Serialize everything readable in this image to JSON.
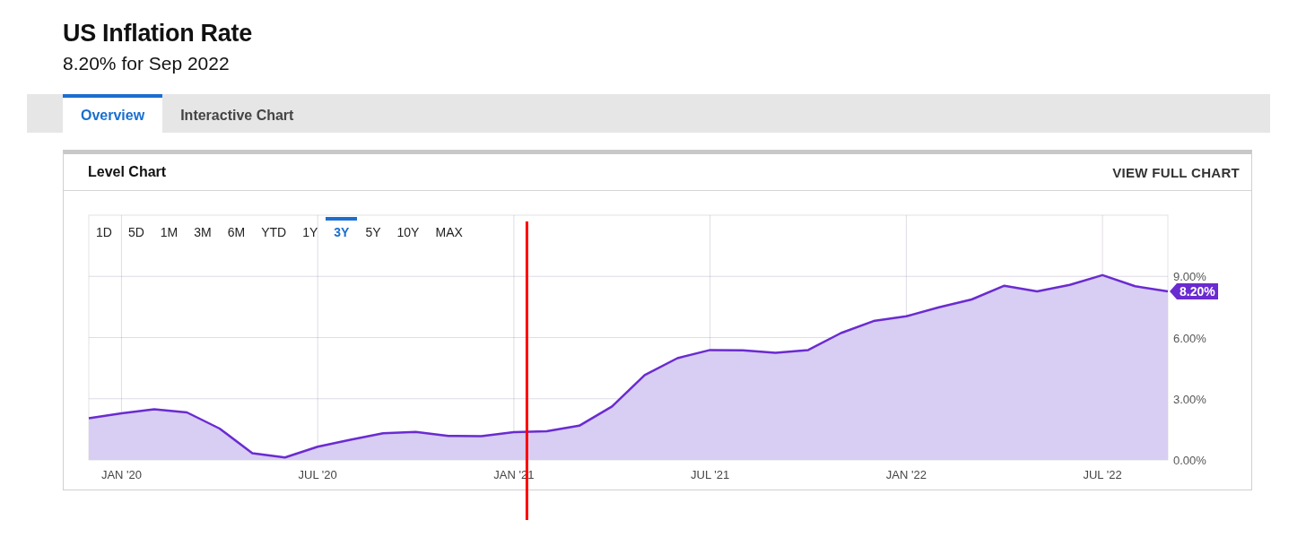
{
  "header": {
    "title": "US Inflation Rate",
    "subtitle": "8.20% for Sep 2022"
  },
  "tabs": [
    {
      "label": "Overview",
      "selected": true
    },
    {
      "label": "Interactive Chart",
      "selected": false
    }
  ],
  "card": {
    "title": "Level Chart",
    "action": "VIEW FULL CHART",
    "ranges": [
      {
        "label": "1D",
        "selected": false
      },
      {
        "label": "5D",
        "selected": false
      },
      {
        "label": "1M",
        "selected": false
      },
      {
        "label": "3M",
        "selected": false
      },
      {
        "label": "6M",
        "selected": false
      },
      {
        "label": "YTD",
        "selected": false
      },
      {
        "label": "1Y",
        "selected": false
      },
      {
        "label": "3Y",
        "selected": true
      },
      {
        "label": "5Y",
        "selected": false
      },
      {
        "label": "10Y",
        "selected": false
      },
      {
        "label": "MAX",
        "selected": false
      }
    ],
    "last_value_label": "8.20%",
    "chart_data": {
      "type": "area",
      "categories": [
        null,
        "JAN '20",
        null,
        null,
        null,
        null,
        null,
        "JUL '20",
        null,
        null,
        null,
        null,
        null,
        "JAN '21",
        null,
        null,
        null,
        null,
        null,
        "JUL '21",
        null,
        null,
        null,
        null,
        null,
        "JAN '22",
        null,
        null,
        null,
        null,
        null,
        "JUL '22",
        null,
        null
      ],
      "series": [
        {
          "color": "#6a2bd1",
          "values": [
            2.05,
            2.29,
            2.49,
            2.33,
            1.54,
            0.33,
            0.12,
            0.65,
            0.99,
            1.31,
            1.37,
            1.18,
            1.17,
            1.36,
            1.4,
            1.68,
            2.62,
            4.16,
            4.99,
            5.39,
            5.37,
            5.25,
            5.39,
            6.22,
            6.81,
            7.04,
            7.48,
            7.87,
            8.54,
            8.26,
            8.58,
            9.06,
            8.52,
            8.26
          ]
        }
      ],
      "ylim": [
        0,
        12
      ],
      "yticks": [
        {
          "value": 0,
          "label": "0.00%"
        },
        {
          "value": 3,
          "label": "3.00%"
        },
        {
          "value": 6,
          "label": "6.00%"
        },
        {
          "value": 9,
          "label": "9.00%"
        }
      ],
      "grid": true
    }
  }
}
